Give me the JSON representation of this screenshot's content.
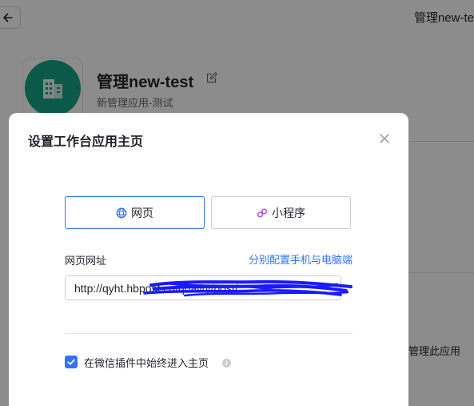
{
  "header": {
    "title": "管理new-te"
  },
  "app": {
    "name": "管理new-test",
    "description": "新管理应用-测试"
  },
  "background": {
    "right_text": "内管理此应用"
  },
  "modal": {
    "title": "设置工作台应用主页",
    "type_buttons": {
      "web": "网页",
      "mini_program": "小程序"
    },
    "url_label": "网页网址",
    "split_link": "分别配置手机与电脑端",
    "url_value": "http://qyht.hbpost.cn/quality/post/",
    "checkbox_label": "在微信插件中始终进入主页",
    "checkbox_checked": true
  },
  "colors": {
    "accent": "#3370ff",
    "app_icon_bg": "#14a385",
    "mini_program_icon": "#b04cf0",
    "scribble": "#1a1aff"
  },
  "icons": {
    "back": "arrow-left-icon",
    "edit": "edit-icon",
    "app": "building-icon",
    "close": "close-icon",
    "web": "globe-icon",
    "mini_program": "mini-program-icon",
    "info": "info-icon",
    "check": "check-icon"
  }
}
